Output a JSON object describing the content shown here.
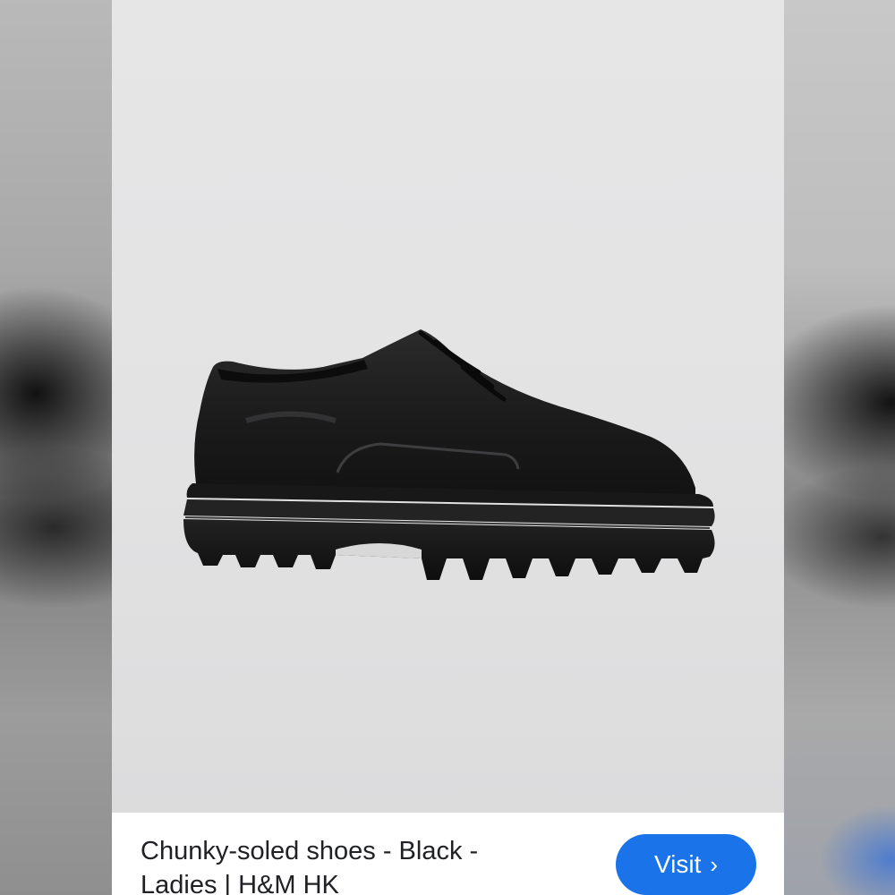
{
  "result": {
    "image_alt": "Chunky-soled shoes - Black - Ladies | H&M HK",
    "title": "Chunky-soled shoes - Black - Ladies | H&M HK",
    "visit_label": "Visit",
    "visit_icon": "chevron-right-icon",
    "visit_chevron_glyph": "›"
  },
  "colors": {
    "accent": "#1a73e8",
    "photo_background": "#e4e4e5",
    "product": "#1b1b1b"
  }
}
